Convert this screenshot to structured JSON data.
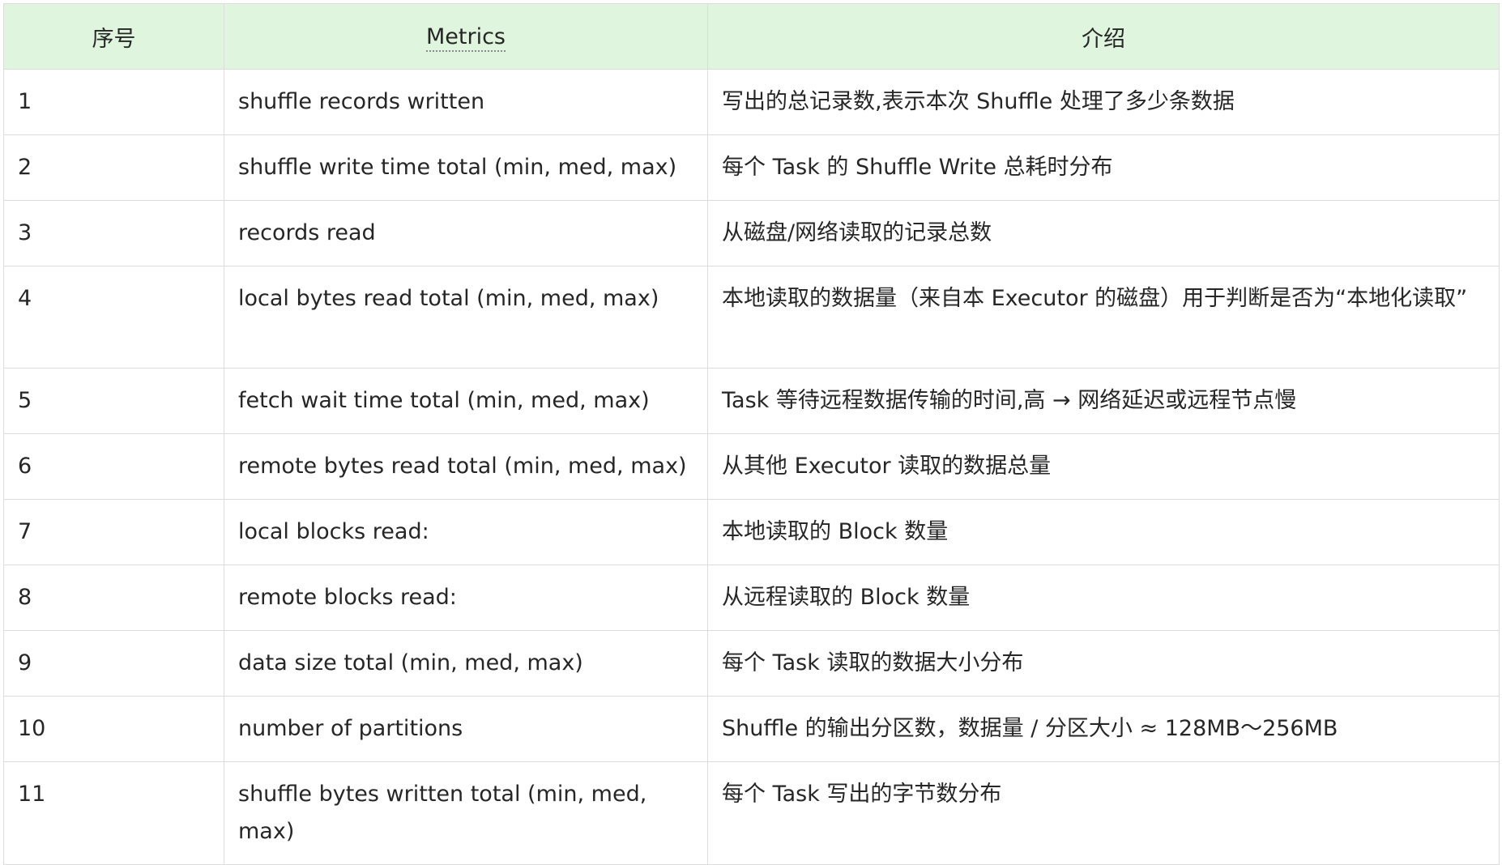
{
  "table": {
    "headers": [
      "序号",
      "Metrics",
      "介绍"
    ],
    "rows": [
      {
        "index": "1",
        "metric": "shuffle records written",
        "desc": "写出的总记录数,表示本次 Shuffle 处理了多少条数据"
      },
      {
        "index": "2",
        "metric": "shuffle write time total (min, med, max)",
        "desc": "每个 Task 的 Shuffle Write 总耗时分布"
      },
      {
        "index": "3",
        "metric": "records read",
        "desc": "从磁盘/网络读取的记录总数"
      },
      {
        "index": "4",
        "metric": "local bytes read total (min, med, max)",
        "desc": "本地读取的数据量（来自本 Executor 的磁盘）用于判断是否为“本地化读取”"
      },
      {
        "index": "5",
        "metric": "fetch wait time total (min, med, max)",
        "desc": "Task 等待远程数据传输的时间,高 → 网络延迟或远程节点慢"
      },
      {
        "index": "6",
        "metric": "remote bytes read total (min, med, max)",
        "desc": "从其他 Executor 读取的数据总量"
      },
      {
        "index": "7",
        "metric": "local blocks read:",
        "desc": "本地读取的 Block 数量"
      },
      {
        "index": "8",
        "metric": "remote blocks read:",
        "desc": "从远程读取的 Block 数量"
      },
      {
        "index": "9",
        "metric": "data size total (min, med, max)",
        "desc": "每个 Task 读取的数据大小分布"
      },
      {
        "index": "10",
        "metric": "number of partitions",
        "desc": "Shuffle 的输出分区数，数据量 / 分区大小 ≈ 128MB～256MB"
      },
      {
        "index": "11",
        "metric": "shuffle bytes written total (min, med, max)",
        "desc": "每个 Task 写出的字节数分布"
      }
    ]
  }
}
